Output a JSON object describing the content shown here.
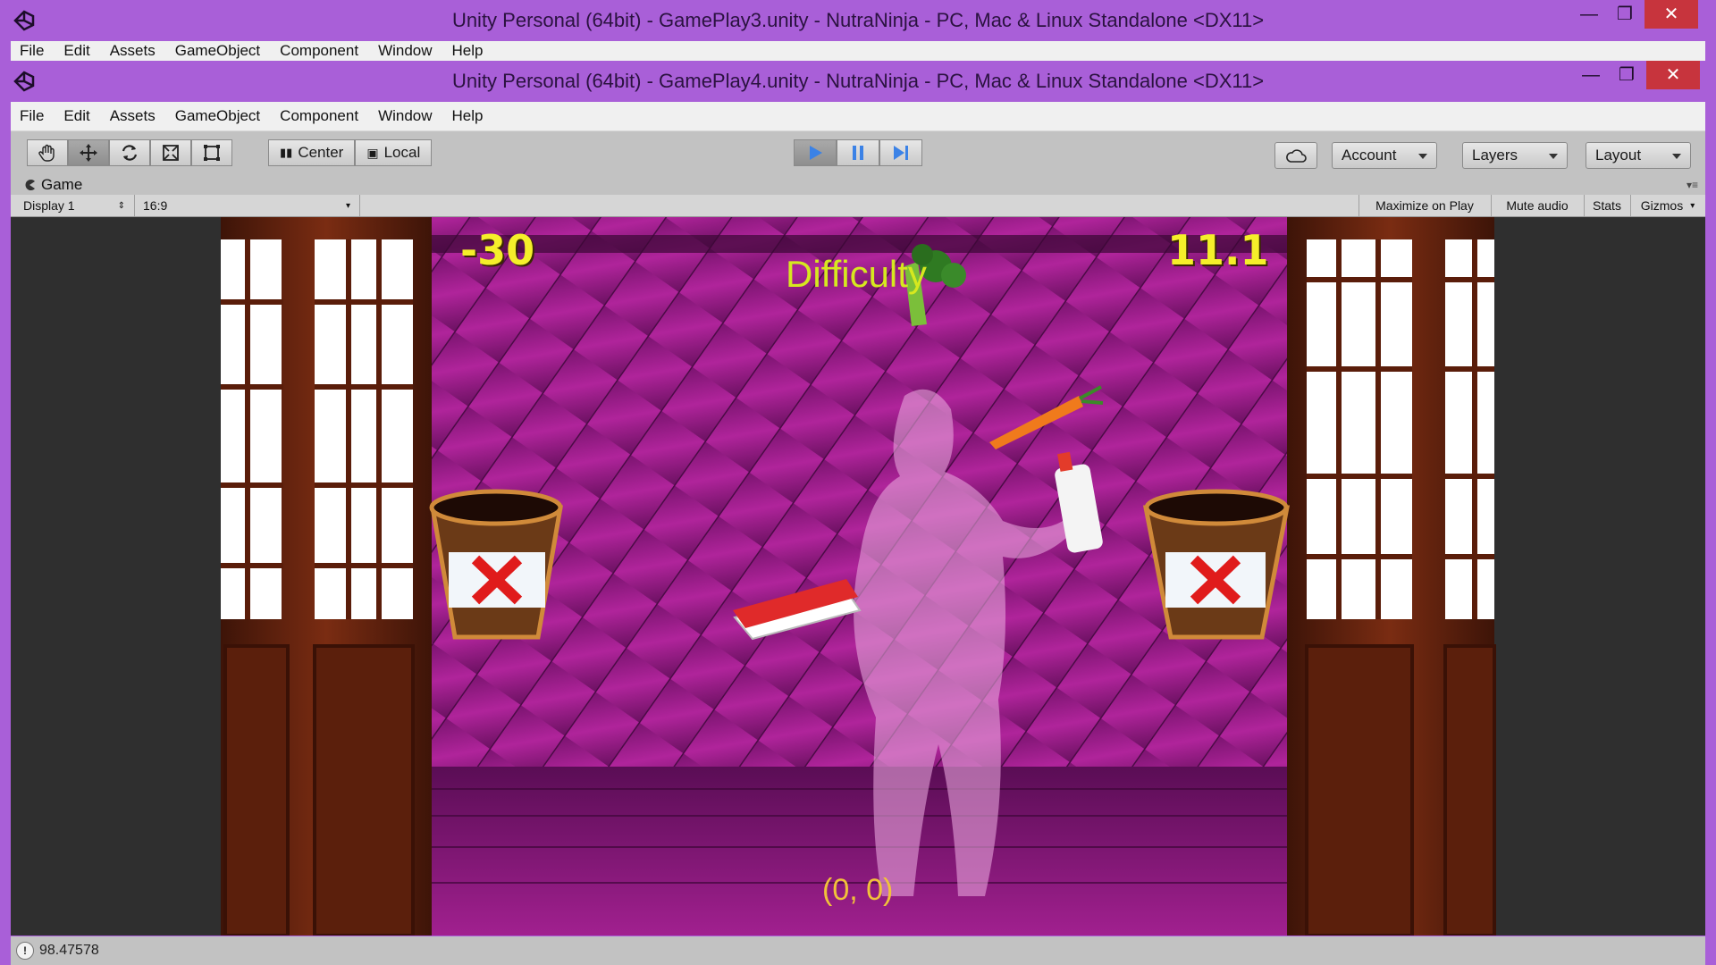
{
  "back_window": {
    "title": "Unity Personal (64bit) - GamePlay3.unity - NutraNinja - PC, Mac & Linux Standalone <DX11>",
    "menu": [
      "File",
      "Edit",
      "Assets",
      "GameObject",
      "Component",
      "Window",
      "Help"
    ]
  },
  "front_window": {
    "title": "Unity Personal (64bit) - GamePlay4.unity - NutraNinja - PC, Mac & Linux Standalone <DX11>",
    "menu": [
      "File",
      "Edit",
      "Assets",
      "GameObject",
      "Component",
      "Window",
      "Help"
    ]
  },
  "toolbar": {
    "tools": [
      "hand-icon",
      "move-icon",
      "rotate-icon",
      "scale-icon",
      "rect-icon"
    ],
    "pivot_label": "Center",
    "space_label": "Local",
    "play_controls": [
      "play-icon",
      "pause-icon",
      "step-icon"
    ],
    "account_label": "Account",
    "layers_label": "Layers",
    "layout_label": "Layout",
    "accent_color": "#3b82e6"
  },
  "game_panel": {
    "tab_label": "Game",
    "display_label": "Display 1",
    "aspect_label": "16:9",
    "maximize_label": "Maximize on Play",
    "mute_label": "Mute audio",
    "stats_label": "Stats",
    "gizmos_label": "Gizmos"
  },
  "game_view": {
    "score": "-30",
    "timer": "11.1",
    "difficulty": "Difficulty",
    "coords": "(0, 0)",
    "items": [
      "broccoli",
      "carrot",
      "whipped-cream-can",
      "sushi"
    ]
  },
  "status": {
    "message": "98.47578"
  }
}
